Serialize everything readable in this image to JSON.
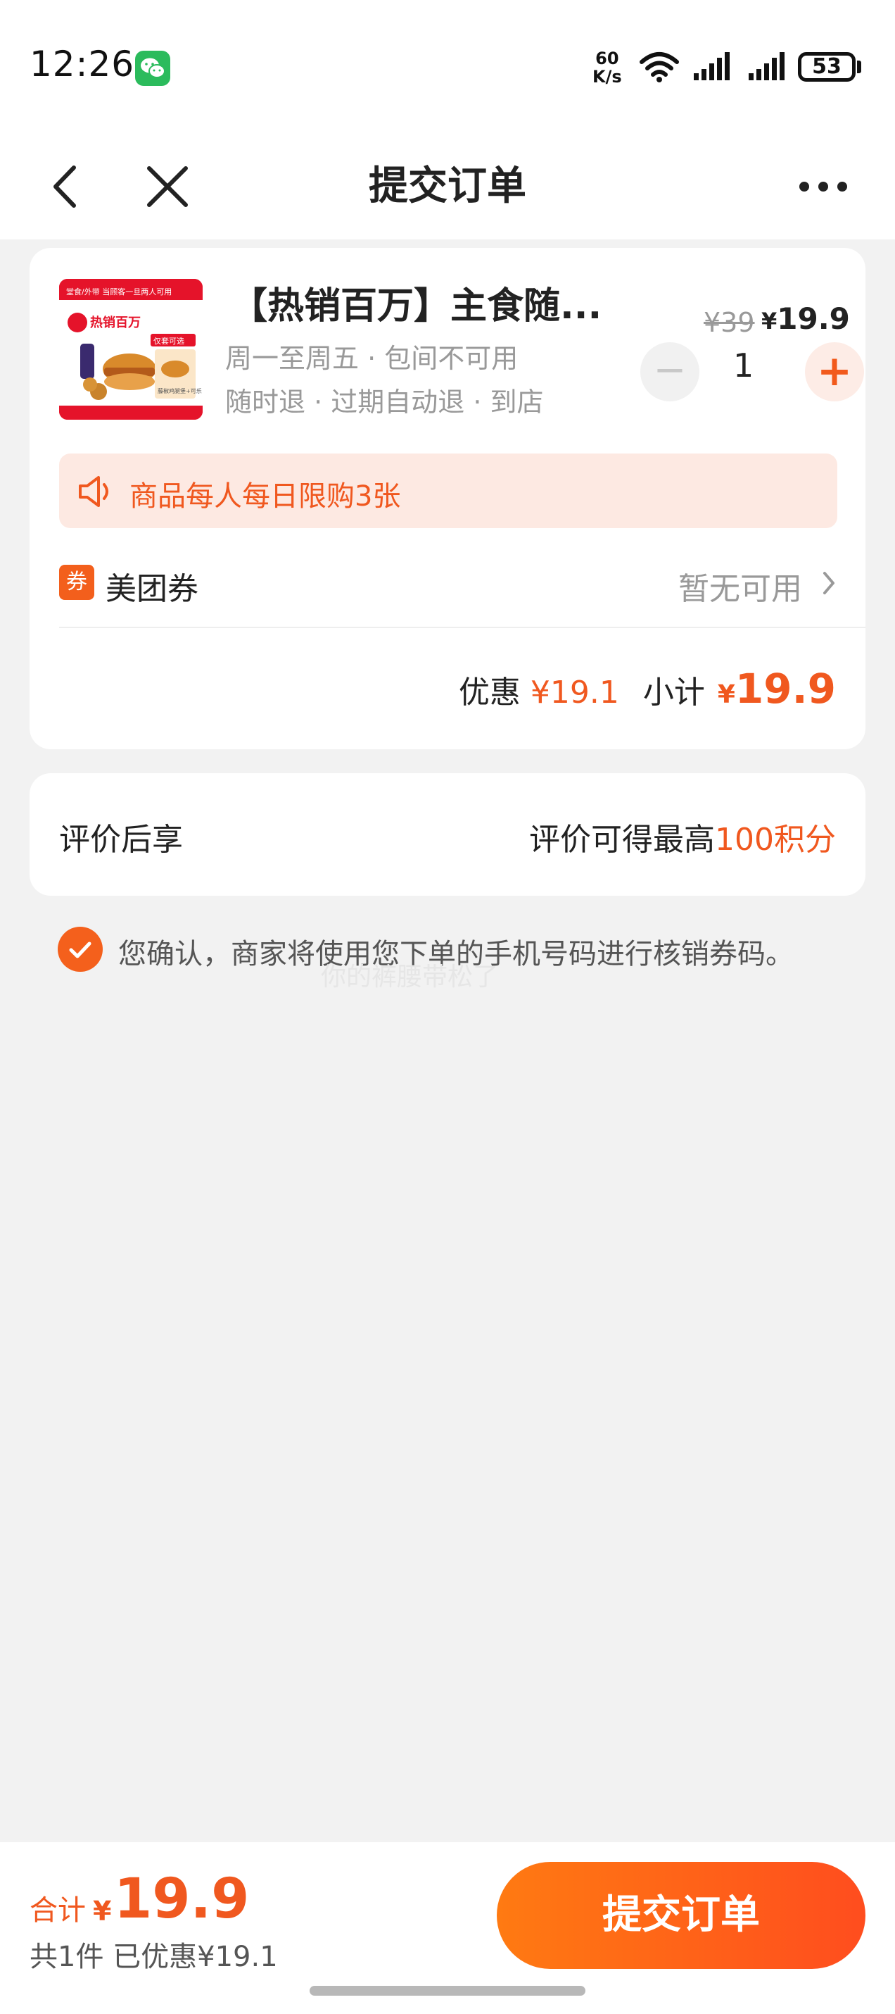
{
  "status_bar": {
    "time": "12:26",
    "net_speed_value": "60",
    "net_speed_unit": "K/s",
    "battery": "53",
    "icons": [
      "wechat-icon",
      "wifi-icon",
      "signal-icon",
      "signal-icon",
      "battery-icon"
    ]
  },
  "nav": {
    "title": "提交订单",
    "back_icon": "chevron-left-icon",
    "close_icon": "close-icon",
    "more_icon": "more-icon"
  },
  "product": {
    "title": "【热销百万】主食随...",
    "line1": "周一至周五 · 包间不可用",
    "line2": "随时退 · 过期自动退 · 到店",
    "original_price": "¥39",
    "price_symbol": "¥",
    "price": "19.9",
    "quantity": "1",
    "minus_label": "−",
    "plus_label": "+",
    "image_text": {
      "top_strip": "堂食/外带  当顾客一旦两人可用",
      "brand": "热销百万",
      "tag": "仅套可选",
      "caption": "藤椒鸡腿堡+可乐"
    }
  },
  "limit_notice": "商品每人每日限购3张",
  "coupon": {
    "badge": "券",
    "label": "美团券",
    "status": "暂无可用"
  },
  "summary": {
    "discount_label": "优惠",
    "discount_value": "¥19.1",
    "subtotal_label": "小计",
    "subtotal_symbol": "¥",
    "subtotal_value": "19.9"
  },
  "review": {
    "label": "评价后享",
    "prefix": "评价可得最高",
    "points": "100积分"
  },
  "confirm_text": "您确认，商家将使用您下单的手机号码进行核销券码。",
  "watermark": "你的裤腰带松了",
  "footer": {
    "total_label": "合计",
    "total_symbol": "¥",
    "total_value": "19.9",
    "count_text": "共1件  已优惠¥19.1",
    "submit_label": "提交订单"
  },
  "colors": {
    "accent": "#f0581f",
    "button_gradient_start": "#ff7a12",
    "button_gradient_end": "#ff4d1e",
    "background": "#f2f2f2"
  }
}
